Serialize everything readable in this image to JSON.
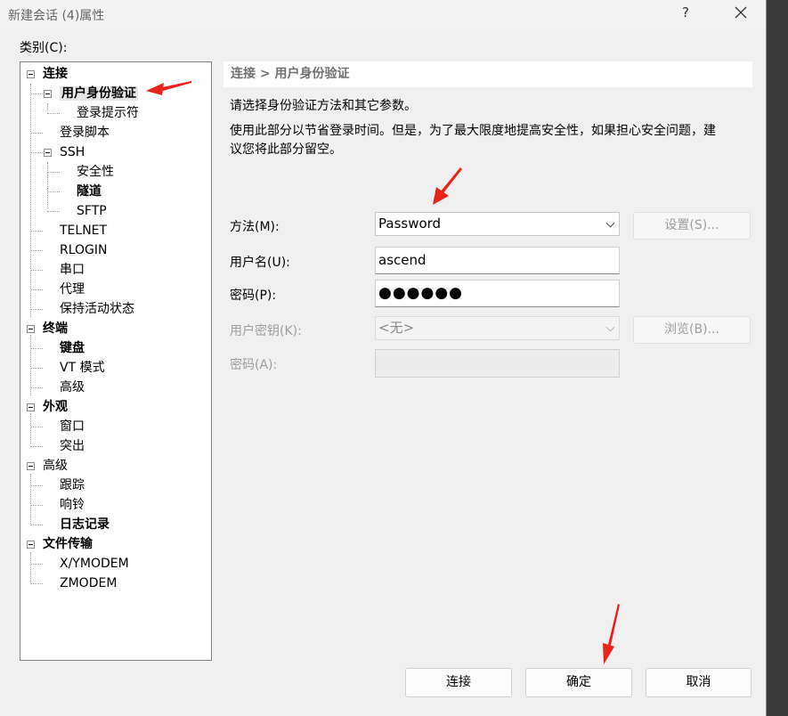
{
  "window": {
    "title": "新建会话 (4)属性",
    "help_glyph": "?"
  },
  "category_label": "类别(C):",
  "tree": [
    {
      "label": "连接",
      "bold": true
    },
    {
      "label": "用户身份验证",
      "bold": true,
      "selected": true
    },
    {
      "label": "登录提示符",
      "bold": false
    },
    {
      "label": "登录脚本",
      "bold": false
    },
    {
      "label": "SSH",
      "bold": false
    },
    {
      "label": "安全性",
      "bold": false
    },
    {
      "label": "隧道",
      "bold": true
    },
    {
      "label": "SFTP",
      "bold": false
    },
    {
      "label": "TELNET",
      "bold": false
    },
    {
      "label": "RLOGIN",
      "bold": false
    },
    {
      "label": "串口",
      "bold": false
    },
    {
      "label": "代理",
      "bold": false
    },
    {
      "label": "保持活动状态",
      "bold": false
    },
    {
      "label": "终端",
      "bold": true
    },
    {
      "label": "键盘",
      "bold": true
    },
    {
      "label": "VT 模式",
      "bold": false
    },
    {
      "label": "高级",
      "bold": false
    },
    {
      "label": "外观",
      "bold": true
    },
    {
      "label": "窗口",
      "bold": false
    },
    {
      "label": "突出",
      "bold": false
    },
    {
      "label": "高级",
      "bold": false
    },
    {
      "label": "跟踪",
      "bold": false
    },
    {
      "label": "响铃",
      "bold": false
    },
    {
      "label": "日志记录",
      "bold": true
    },
    {
      "label": "文件传输",
      "bold": true
    },
    {
      "label": "X/YMODEM",
      "bold": false
    },
    {
      "label": "ZMODEM",
      "bold": false
    }
  ],
  "panel": {
    "breadcrumb": "连接 > 用户身份验证",
    "desc1": "请选择身份验证方法和其它参数。",
    "desc2": "使用此部分以节省登录时间。但是，为了最大限度地提高安全性，如果担心安全问题，建",
    "desc3": "议您将此部分留空。",
    "method_label": "方法(M):",
    "method_value": "Password",
    "settings_button": "设置(S)...",
    "username_label": "用户名(U):",
    "username_value": "ascend",
    "password_label": "密码(P):",
    "password_value": "●●●●●●",
    "userkey_label": "用户密钥(K):",
    "userkey_value": "<无>",
    "browse_button": "浏览(B)...",
    "passphrase_label": "密码(A):"
  },
  "buttons": {
    "connect": "连接",
    "ok": "确定",
    "cancel": "取消"
  },
  "colors": {
    "annotation_arrow": "#e8231a",
    "window_bg": "#f0f0f0"
  }
}
